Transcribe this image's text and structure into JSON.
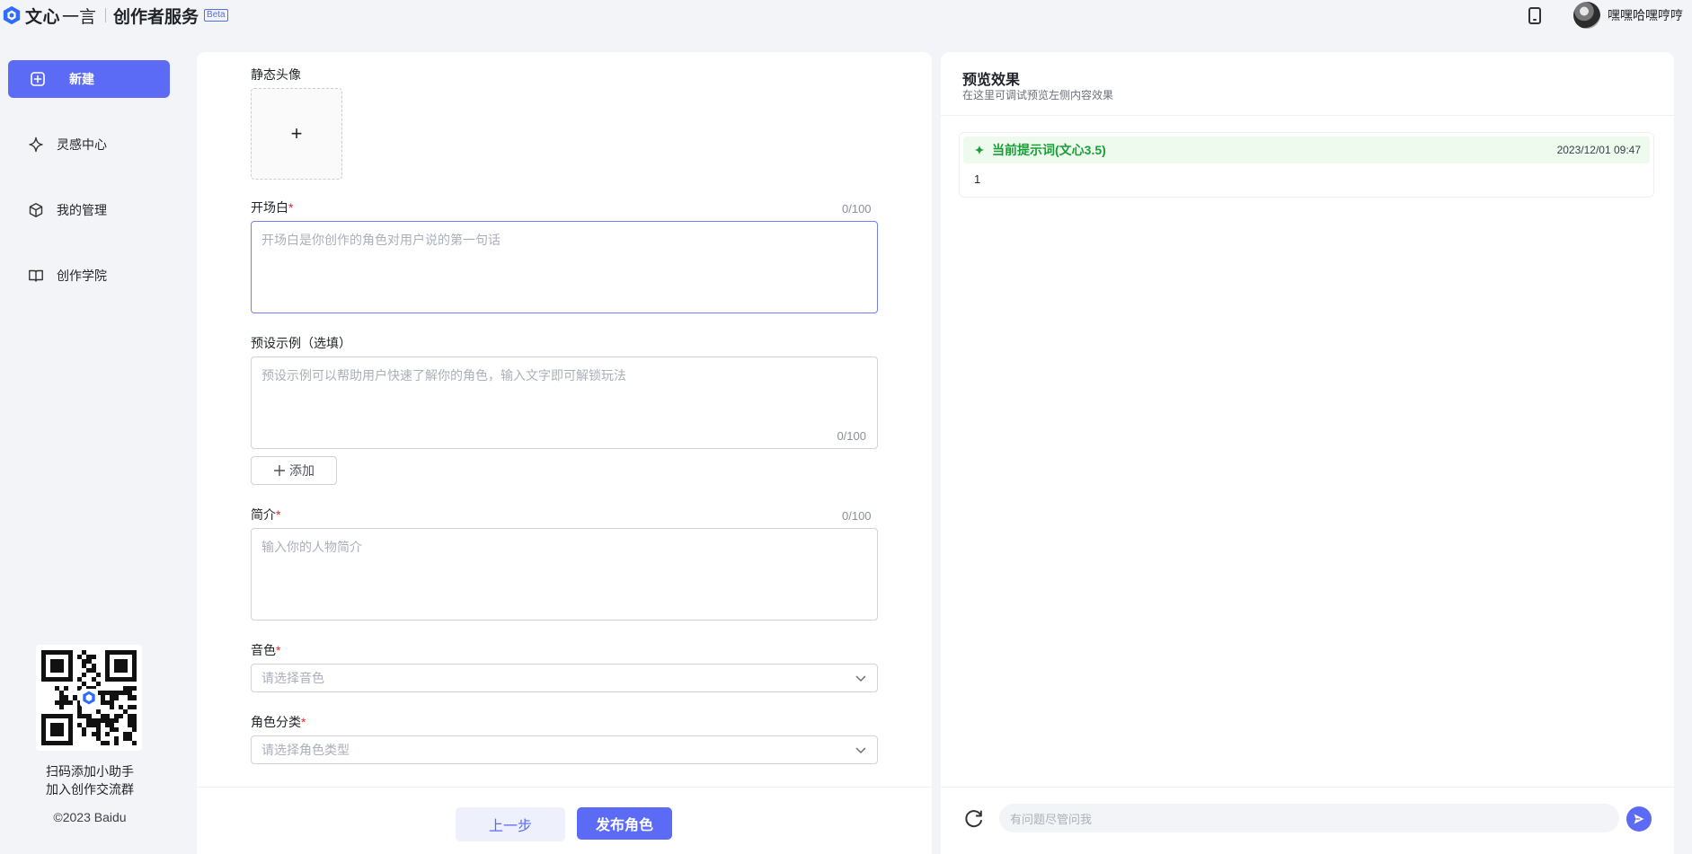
{
  "header": {
    "brand_name": "文心",
    "brand_name_light": "一言",
    "product_name": "创作者服务",
    "beta_label": "Beta",
    "phone_icon": "mobile-icon",
    "username": "嘿嘿哈嘿哼哼"
  },
  "sidebar": {
    "items": [
      {
        "label": "新建",
        "icon": "plus-square-icon",
        "active": true
      },
      {
        "label": "灵感中心",
        "icon": "sparkle-icon",
        "active": false
      },
      {
        "label": "我的管理",
        "icon": "cube-icon",
        "active": false
      },
      {
        "label": "创作学院",
        "icon": "book-icon",
        "active": false
      }
    ],
    "qr_caption_line1": "扫码添加小助手",
    "qr_caption_line2": "加入创作交流群",
    "copyright": "©2023 Baidu"
  },
  "form": {
    "avatar_label": "静态头像",
    "avatar_upload_symbol": "+",
    "greeting": {
      "label": "开场白",
      "required": "*",
      "counter": "0/100",
      "placeholder": "开场白是你创作的角色对用户说的第一句话"
    },
    "examples": {
      "label": "预设示例（选填）",
      "counter": "0/100",
      "placeholder": "预设示例可以帮助用户快速了解你的角色，输入文字即可解锁玩法",
      "add_button": "添加"
    },
    "intro": {
      "label": "简介",
      "required": "*",
      "counter": "0/100",
      "placeholder": "输入你的人物简介"
    },
    "voice": {
      "label": "音色",
      "required": "*",
      "placeholder": "请选择音色"
    },
    "category": {
      "label": "角色分类",
      "required": "*",
      "placeholder": "请选择角色类型"
    },
    "prev_button": "上一步",
    "publish_button": "发布角色"
  },
  "preview": {
    "title": "预览效果",
    "subtitle": "在这里可调试预览左侧内容效果",
    "prompt_title": "当前提示词(文心3.5)",
    "prompt_time": "2023/12/01 09:47",
    "prompt_body": "1",
    "chat_placeholder": "有问题尽管问我"
  },
  "colors": {
    "accent": "#5b6bf5",
    "required": "#f5222d",
    "prompt_green": "#1a9e36",
    "page_bg": "#f3f4f8"
  }
}
